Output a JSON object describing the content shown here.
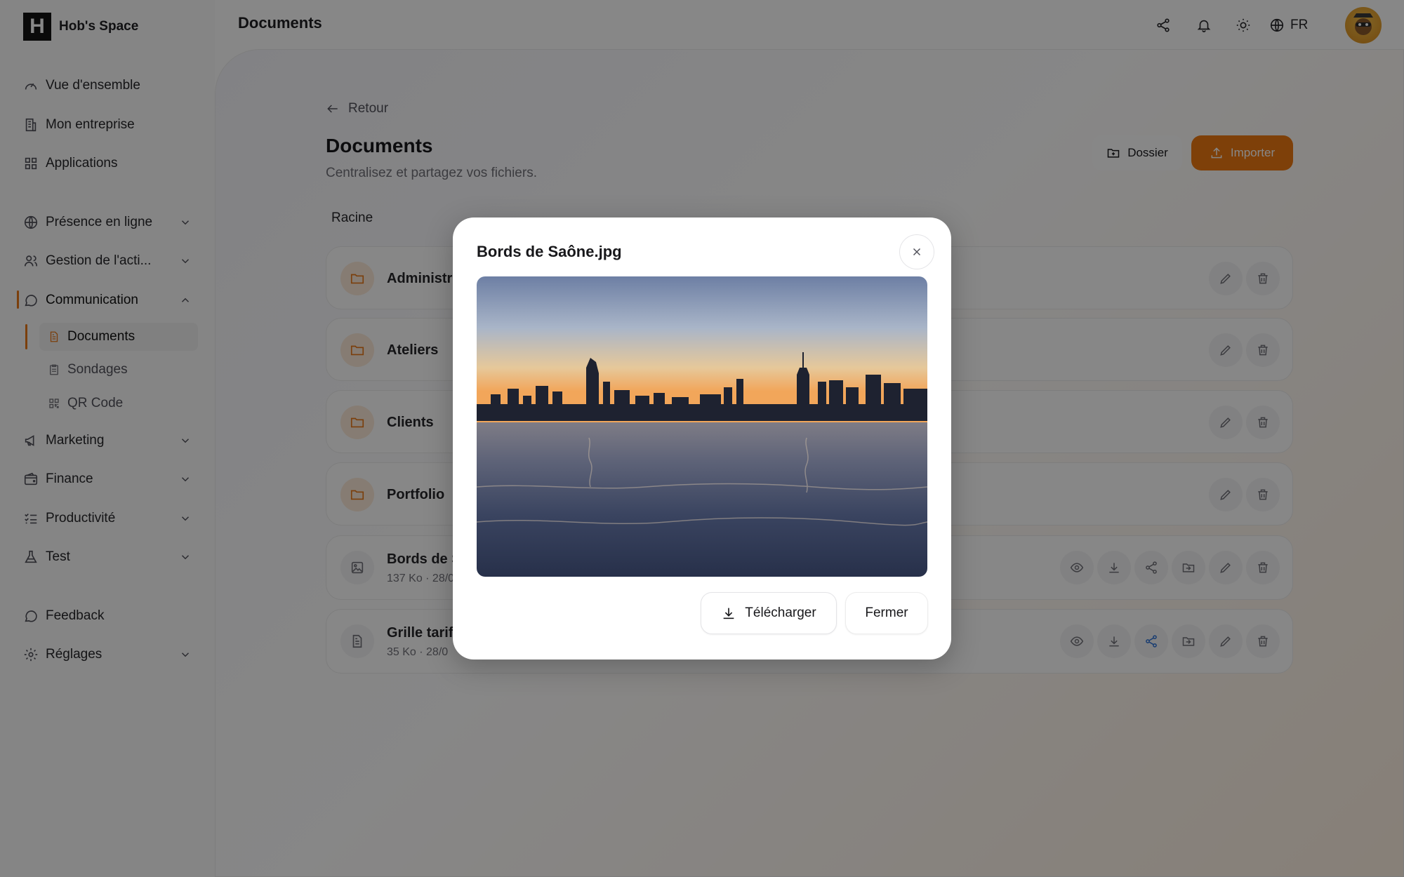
{
  "brand": {
    "name": "Hob's Space",
    "logo_letter": "H"
  },
  "header": {
    "title": "Documents",
    "lang": "FR"
  },
  "sidebar": {
    "items": [
      {
        "label": "Vue d'ensemble",
        "icon": "gauge-icon"
      },
      {
        "label": "Mon entreprise",
        "icon": "building-icon"
      },
      {
        "label": "Applications",
        "icon": "grid-icon"
      },
      {
        "label": "Présence en ligne",
        "icon": "globe-icon"
      },
      {
        "label": "Gestion de l'acti...",
        "icon": "users-icon"
      },
      {
        "label": "Communication",
        "icon": "message-circle-icon"
      },
      {
        "label": "Marketing",
        "icon": "megaphone-icon"
      },
      {
        "label": "Finance",
        "icon": "wallet-icon"
      },
      {
        "label": "Productivité",
        "icon": "list-checks-icon"
      },
      {
        "label": "Test",
        "icon": "flask-icon"
      },
      {
        "label": "Feedback",
        "icon": "message-icon"
      },
      {
        "label": "Réglages",
        "icon": "gear-icon"
      }
    ],
    "sub_items": [
      {
        "label": "Documents",
        "icon": "file-text-icon"
      },
      {
        "label": "Sondages",
        "icon": "clipboard-icon"
      },
      {
        "label": "QR Code",
        "icon": "qr-code-icon"
      }
    ]
  },
  "page": {
    "back_label": "Retour",
    "title": "Documents",
    "subtitle": "Centralisez et partagez vos fichiers.",
    "folder_button": "Dossier",
    "import_button": "Importer",
    "breadcrumb": "Racine"
  },
  "rows": [
    {
      "name": "Administra",
      "meta": "",
      "kind": "folder"
    },
    {
      "name": "Ateliers",
      "meta": "",
      "kind": "folder"
    },
    {
      "name": "Clients",
      "meta": "",
      "kind": "folder"
    },
    {
      "name": "Portfolio",
      "meta": "",
      "kind": "folder"
    },
    {
      "name": "Bords de S",
      "meta": "137 Ko · 28/0",
      "kind": "image"
    },
    {
      "name": "Grille tarifa",
      "meta": "35 Ko · 28/0",
      "kind": "file"
    }
  ],
  "modal": {
    "title": "Bords de Saône.jpg",
    "download_label": "Télécharger",
    "close_label": "Fermer"
  },
  "colors": {
    "accent": "#ee7a12",
    "share_active": "#2f72d6"
  }
}
